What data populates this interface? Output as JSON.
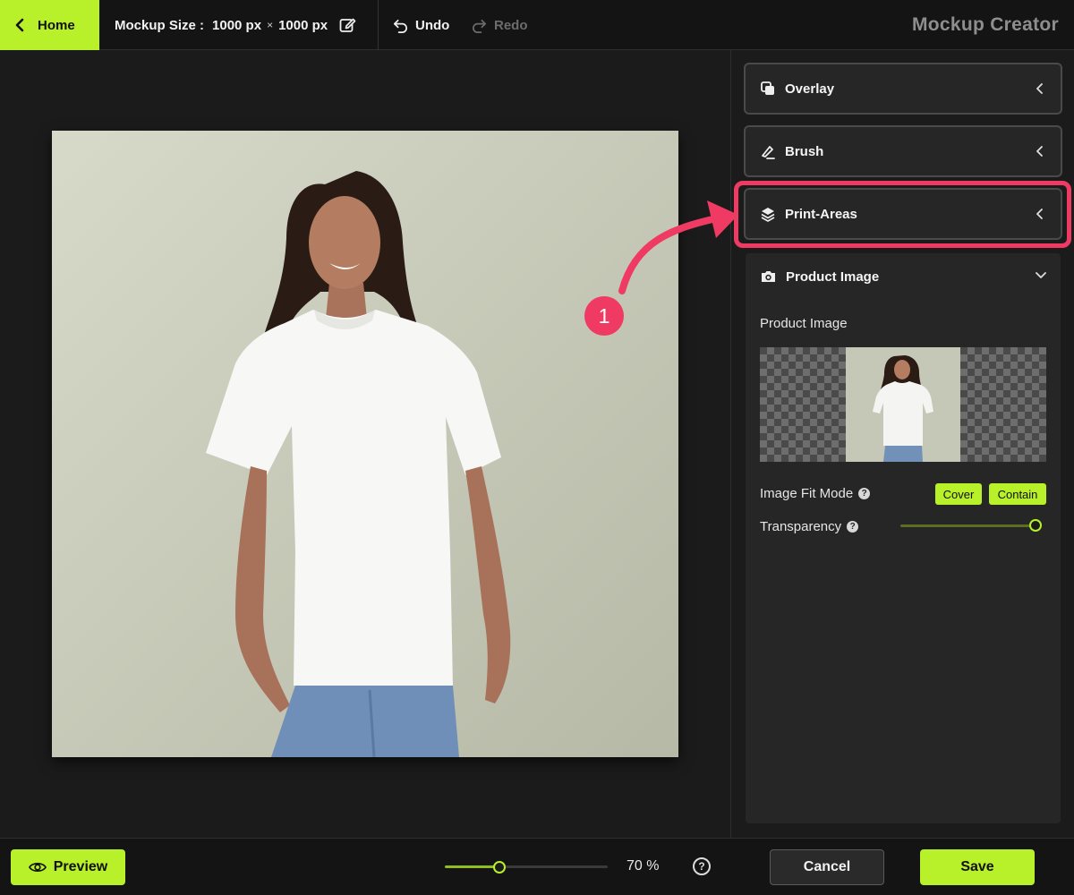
{
  "topbar": {
    "home_label": "Home",
    "size_label": "Mockup Size :",
    "width": "1000 px",
    "times": "×",
    "height": "1000 px",
    "undo_label": "Undo",
    "redo_label": "Redo",
    "app_title": "Mockup Creator"
  },
  "annotation": {
    "step": "1"
  },
  "panel": {
    "overlay_label": "Overlay",
    "brush_label": "Brush",
    "print_areas_label": "Print-Areas",
    "product_image": {
      "header": "Product Image",
      "field_label": "Product Image",
      "fit_mode_label": "Image Fit Mode",
      "fit_options": [
        "Cover",
        "Contain"
      ],
      "transparency_label": "Transparency",
      "transparency_value": 1.0
    }
  },
  "bottombar": {
    "preview_label": "Preview",
    "zoom_value": "70 %",
    "zoom_fraction": 0.33,
    "help": "?",
    "cancel_label": "Cancel",
    "save_label": "Save"
  },
  "colors": {
    "accent": "#b8f02a",
    "highlight": "#ef3b63",
    "background": "#1b1b1b",
    "panel": "#262626"
  },
  "icons": [
    "chevron-left-icon",
    "edit-icon",
    "undo-icon",
    "redo-icon",
    "overlay-icon",
    "brush-icon",
    "layers-icon",
    "camera-icon",
    "chevron-down-icon",
    "help-icon",
    "eye-icon"
  ]
}
